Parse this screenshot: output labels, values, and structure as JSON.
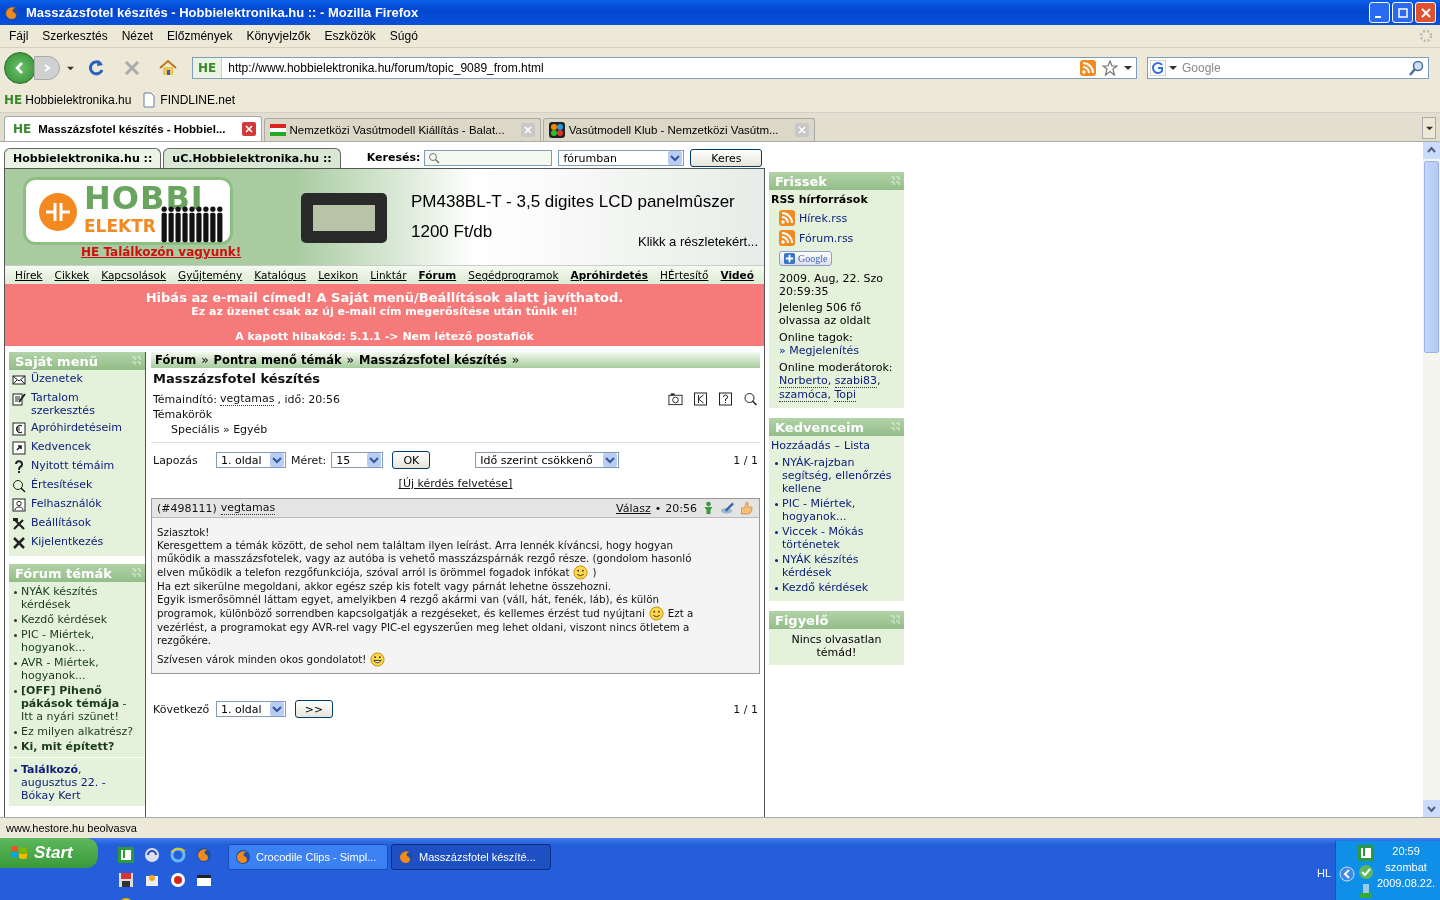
{
  "window": {
    "title": "Masszázsfotel készítés - Hobbielektronika.hu :: - Mozilla Firefox"
  },
  "menu": [
    "Fájl",
    "Szerkesztés",
    "Nézet",
    "Előzmények",
    "Könyvjelzők",
    "Eszközök",
    "Súgó"
  ],
  "navbar": {
    "icon_text": "HE",
    "url": "http://www.hobbielektronika.hu/forum/topic_9089_from.html",
    "search_placeholder": "Google"
  },
  "bookmarks": [
    {
      "kind": "site",
      "icon_text": "HE",
      "label": "Hobbielektronika.hu"
    },
    {
      "kind": "page",
      "label": "FINDLINE.net"
    }
  ],
  "tabs": [
    {
      "kind": "site",
      "icon_text": "HE",
      "label": "Masszázsfotel készítés - Hobbiel...",
      "selected": true
    },
    {
      "kind": "flag",
      "label": "Nemzetközi Vasútmodell Kiállítás - Balat...",
      "selected": false
    },
    {
      "kind": "puzzle",
      "label": "Vasútmodell Klub - Nemzetközi Vasútm...",
      "selected": false
    }
  ],
  "site_tabs": [
    {
      "label": "Hobbielektronika.hu ::",
      "selected": true
    },
    {
      "label": "uC.Hobbielektronika.hu ::",
      "selected": false
    }
  ],
  "site_search": {
    "label": "Keresés:",
    "scope": "fórumban",
    "button": "Keres"
  },
  "banner": {
    "logo_line1": "HOBBI",
    "logo_line2": "ELEKTR",
    "meetup_link": "HE Találkozón vagyunk!",
    "ad_title": "PM438BL-T - 3,5 digites LCD panelmûszer",
    "ad_price": "1200 Ft/db",
    "ad_link": "Klikk a részletekért..."
  },
  "nav_links": [
    {
      "label": "Hírek",
      "bold": false
    },
    {
      "label": "Cikkek",
      "bold": false
    },
    {
      "label": "Kapcsolások",
      "bold": false
    },
    {
      "label": "Gyűjtemény",
      "bold": false
    },
    {
      "label": "Katalógus",
      "bold": false
    },
    {
      "label": "Lexikon",
      "bold": false
    },
    {
      "label": "Linktár",
      "bold": false
    },
    {
      "label": "Fórum",
      "bold": true
    },
    {
      "label": "Segédprogramok",
      "bold": false
    },
    {
      "label": "Apróhirdetés",
      "bold": true
    },
    {
      "label": "HÉrtesítő",
      "bold": false
    },
    {
      "label": "Videó",
      "bold": true
    }
  ],
  "alert": {
    "line1": "Hibás az e-mail címed! A Saját menü/Beállítások alatt javíthatod.",
    "line2": "Ez az üzenet csak az új e-mail cím megerősítése után tűnik el!",
    "line3": "A kapott hibakód: 5.1.1 -> Nem létező postafiók"
  },
  "my_menu": {
    "title": "Saját menü",
    "items": [
      {
        "kind": "mail",
        "label": "Üzenetek"
      },
      {
        "kind": "edit",
        "label": "Tartalom szerkesztés"
      },
      {
        "kind": "euro",
        "label": "Apróhirdetéseim"
      },
      {
        "kind": "shortcut",
        "label": "Kedvencek"
      },
      {
        "kind": "question",
        "label": "Nyitott témáim"
      },
      {
        "kind": "magnifier",
        "label": "Értesítések"
      },
      {
        "kind": "user",
        "label": "Felhasználók"
      },
      {
        "kind": "tools",
        "label": "Beállítások"
      },
      {
        "kind": "cross",
        "label": "Kijelentkezés"
      }
    ]
  },
  "forum_topics": {
    "title": "Fórum témák",
    "items": [
      "NYÁK készítés kérdések",
      "Kezdő kérdések",
      "PIC - Miértek, hogyanok...",
      "AVR - Miértek, hogyanok...",
      "**[OFF] Pihenő pákások témája** - Itt a nyári szünet!",
      "Ez milyen alkatrész?",
      "**Ki, mit épített?**"
    ],
    "event": "**Találkozó**, augusztus 22. - Bókay Kert"
  },
  "breadcrumb": {
    "items": [
      "Fórum",
      "Pontra menő témák",
      "Masszázsfotel készítés"
    ],
    "separator": "»"
  },
  "topic": {
    "title": "Masszázsfotel készítés",
    "starter_label": "Témaindító:",
    "starter": "vegtamas",
    "starter_time": ", idő: 20:56",
    "categories_label": "Témakörök",
    "categories": "Speciális » Egyéb"
  },
  "paging": {
    "label": "Lapozás",
    "page": "1. oldal",
    "size_label": "Méret:",
    "size": "15",
    "ok": "OK",
    "sort": "Idő szerint csökkenő",
    "count": "1 / 1"
  },
  "new_topic": "[Új kérdés felvetése]",
  "post": {
    "id": "(#498111)",
    "author": "vegtamas",
    "reply": "Válasz",
    "dot": "•",
    "time": "20:56",
    "lines": [
      [
        {
          "kind": "text",
          "text": "Sziasztok!"
        }
      ],
      [
        {
          "kind": "text",
          "text": "Keresgettem a témák között, de sehol nem találtam ilyen leírást. Arra lennék kíváncsi, hogy hogyan"
        }
      ],
      [
        {
          "kind": "text",
          "text": "működik a masszázsfotelek, vagy az autóba is vehető masszázspárnák rezgő része. (gondolom hasonló"
        }
      ],
      [
        {
          "kind": "text",
          "text": "elven működik a telefon rezgőfunkciója, szóval arról is örömmel fogadok infókat"
        },
        {
          "kind": "smile"
        },
        {
          "kind": "text",
          "text": ")"
        }
      ],
      [
        {
          "kind": "text",
          "text": "Ha ezt sikerülne megoldani, akkor egész szép kis fotelt vagy párnát lehetne összehozni."
        }
      ],
      [
        {
          "kind": "text",
          "text": "Egyik ismerősömnél láttam egyet, amelyikben 4 rezgő akármi van (váll, hát, fenék, láb), és külön"
        }
      ],
      [
        {
          "kind": "text",
          "text": "programok, különböző sorrendben kapcsolgatják a rezgéseket, és kellemes érzést tud nyújtani"
        },
        {
          "kind": "smile"
        },
        {
          "kind": "text",
          "text": "Ezt a"
        }
      ],
      [
        {
          "kind": "text",
          "text": "vezérlést, a programokat egy AVR-rel vagy PIC-el egyszerűen meg lehet oldani, viszont nincs ötletem a"
        }
      ],
      [
        {
          "kind": "text",
          "text": "rezgőkére."
        }
      ],
      [
        {
          "kind": "text",
          "text": "Szívesen várok minden okos gondolatot!"
        },
        {
          "kind": "grin"
        }
      ]
    ]
  },
  "bottom_paging": {
    "label": "Következő",
    "page": "1. oldal",
    "button": ">>",
    "count": "1 / 1"
  },
  "fresh": {
    "title": "Frissek",
    "rss_title": "RSS hírforrások",
    "feeds": [
      "Hírek.rss",
      "Fórum.rss"
    ],
    "google_button": "Google",
    "date": "2009. Aug, 22. Szo 20:59:35",
    "readers": "Jelenleg 506 fő olvassa az oldalt",
    "online_label": "Online tagok:",
    "online_link": "» Megjelenítés",
    "mods_label": "Online moderátorok:",
    "mods": [
      {
        "name": "Norberto",
        "sep": ","
      },
      {
        "name": "szabi83",
        "sep": ","
      },
      {
        "name": "szamóca",
        "sep": ","
      },
      {
        "name": "Topi"
      }
    ]
  },
  "favorites": {
    "title": "Kedvenceim",
    "add": "Hozzáadás",
    "sep": "–",
    "list": "Lista",
    "items": [
      "NYÁK-rajzban segítség, ellenőrzés kellene",
      "PIC - Miértek, hogyanok...",
      "Viccek - Mókás történetek",
      "NYÁK készítés kérdések",
      "Kezdő kérdések"
    ]
  },
  "watcher": {
    "title": "Figyelő",
    "text": "Nincs olvasatlan témád!"
  },
  "status_bar": "www.hestore.hu beolvasva",
  "taskbar": {
    "start": "Start",
    "tasks": [
      {
        "label": "Crocodile Clips - Simpl...",
        "selected": false
      },
      {
        "label": "Masszázsfotel készíté...",
        "selected": true
      }
    ],
    "language": "HL",
    "time": "20:59",
    "day": "szombat",
    "date": "2009.08.22."
  }
}
